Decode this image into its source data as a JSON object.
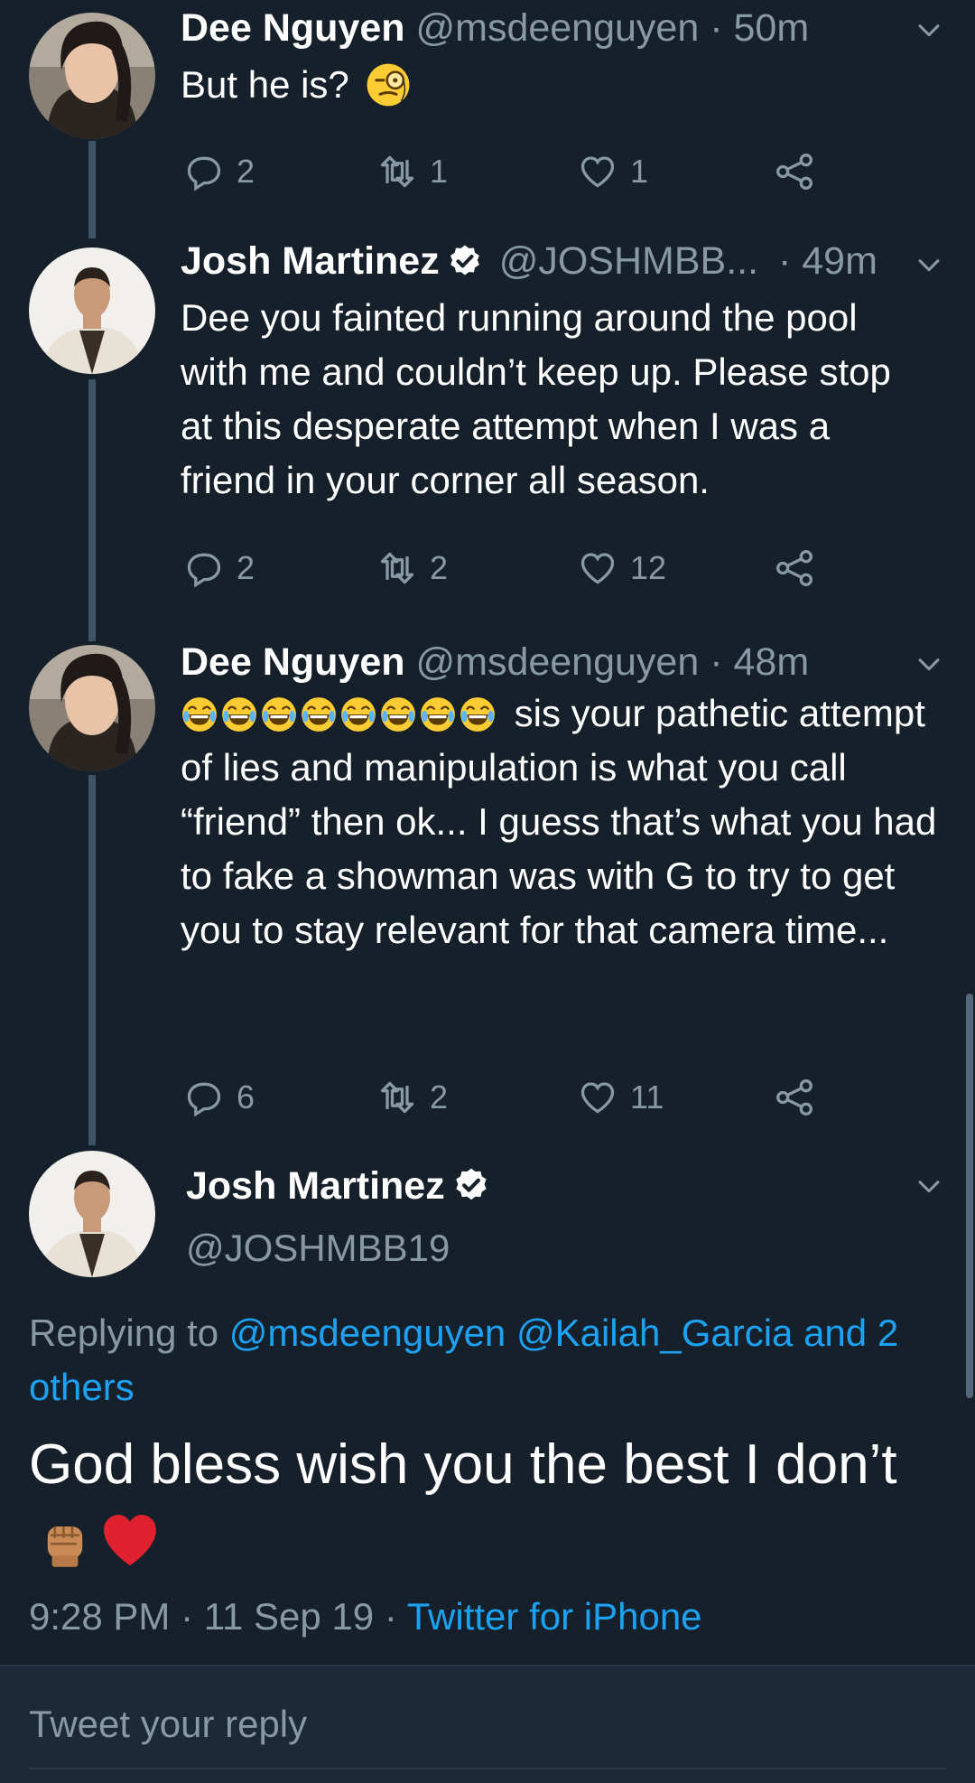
{
  "tweets": [
    {
      "name": "Dee Nguyen",
      "handle": "@msdeenguyen",
      "time": "· 50m",
      "text": "But he is?",
      "reply_count": "2",
      "retweet_count": "1",
      "like_count": "1"
    },
    {
      "name": "Josh Martinez",
      "handle": "@JOSHMBB...",
      "time": "· 49m",
      "text": "Dee you fainted running around the pool with me and couldn’t keep up. Please stop at this desperate attempt when I was a friend in your corner all season.",
      "reply_count": "2",
      "retweet_count": "2",
      "like_count": "12"
    },
    {
      "name": "Dee Nguyen",
      "handle": "@msdeenguyen",
      "time": "· 48m",
      "text": "sis your pathetic attempt of lies and manipulation is what you call “friend” then ok... I guess that’s what you had to fake a showman was with G to try to get you to stay relevant for that camera time...",
      "reply_count": "6",
      "retweet_count": "2",
      "like_count": "11"
    }
  ],
  "main_tweet": {
    "name": "Josh Martinez",
    "handle": "@JOSHMBB19",
    "replying_prefix": "Replying to",
    "replying_to": "@msdeenguyen @Kailah_Garcia and 2 others",
    "text": "God bless wish you the best I don’t",
    "time": "9:28 PM",
    "date": "11 Sep 19",
    "source": "Twitter for iPhone"
  },
  "reply_box": {
    "placeholder": "Tweet your reply"
  },
  "colors": {
    "background": "#15202b",
    "secondary_text": "#8899a6",
    "link": "#1da1f2"
  }
}
